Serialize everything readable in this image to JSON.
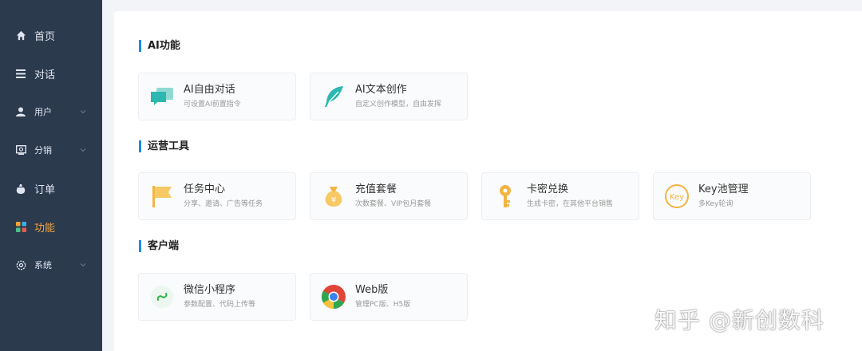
{
  "sidebar": {
    "items": [
      {
        "label": "首页",
        "icon": "home-icon",
        "active": false,
        "expandable": false
      },
      {
        "label": "对话",
        "icon": "menu-icon",
        "active": false,
        "expandable": false
      },
      {
        "label": "用户",
        "icon": "user-icon",
        "active": false,
        "expandable": true
      },
      {
        "label": "分销",
        "icon": "distribution-icon",
        "active": false,
        "expandable": true
      },
      {
        "label": "订单",
        "icon": "order-bag-icon",
        "active": false,
        "expandable": false
      },
      {
        "label": "功能",
        "icon": "apps-grid-icon",
        "active": true,
        "expandable": false
      },
      {
        "label": "系统",
        "icon": "settings-icon",
        "active": false,
        "expandable": true
      }
    ]
  },
  "sections": [
    {
      "title": "AI功能",
      "cards": [
        {
          "title": "AI自由对话",
          "desc": "可设置AI前置指令",
          "icon": "chat-bubble-icon"
        },
        {
          "title": "AI文本创作",
          "desc": "自定义创作模型，自由发挥",
          "icon": "feather-icon"
        }
      ]
    },
    {
      "title": "运营工具",
      "cards": [
        {
          "title": "任务中心",
          "desc": "分享、邀请、广告等任务",
          "icon": "flag-icon"
        },
        {
          "title": "充值套餐",
          "desc": "次数套餐、VIP包月套餐",
          "icon": "money-bag-icon"
        },
        {
          "title": "卡密兑换",
          "desc": "生成卡密，在其他平台销售",
          "icon": "key-icon"
        },
        {
          "title": "Key池管理",
          "desc": "多Key轮询",
          "icon": "key-badge-icon"
        }
      ]
    },
    {
      "title": "客户端",
      "cards": [
        {
          "title": "微信小程序",
          "desc": "参数配置、代码上传等",
          "icon": "mini-program-icon"
        },
        {
          "title": "Web版",
          "desc": "管理PC版、H5版",
          "icon": "chrome-icon"
        }
      ]
    }
  ],
  "watermark": "知乎 @新创数科",
  "colors": {
    "sidebar_bg": "#2c3a4e",
    "active": "#f2a43a",
    "section_bar": "#1f88e5"
  }
}
